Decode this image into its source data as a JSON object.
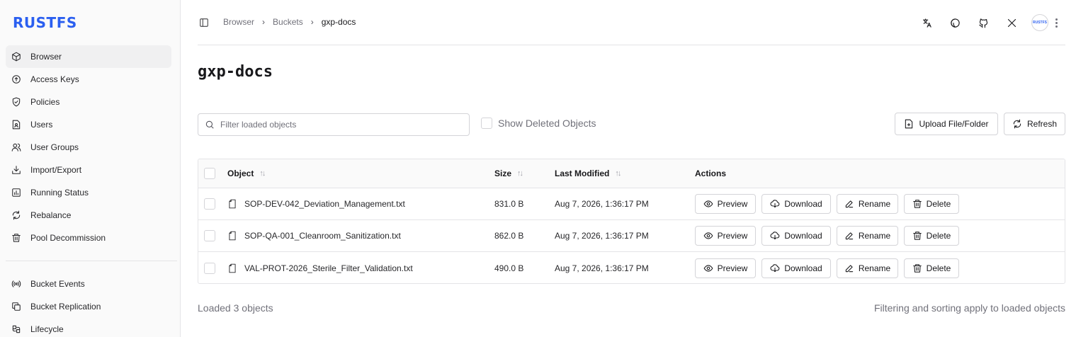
{
  "brand": {
    "logo": "RUSTFS",
    "logo_color": "#2b5ff0"
  },
  "sidebar": {
    "items": [
      {
        "label": "Browser",
        "icon": "box-icon",
        "active": true
      },
      {
        "label": "Access Keys",
        "icon": "key-circle-icon"
      },
      {
        "label": "Policies",
        "icon": "shield-check-icon"
      },
      {
        "label": "Users",
        "icon": "user-file-icon"
      },
      {
        "label": "User Groups",
        "icon": "users-icon"
      },
      {
        "label": "Import/Export",
        "icon": "download-tray-icon"
      },
      {
        "label": "Running Status",
        "icon": "bar-chart-icon"
      },
      {
        "label": "Rebalance",
        "icon": "refresh-icon"
      },
      {
        "label": "Pool Decommission",
        "icon": "trash-icon"
      }
    ],
    "items2": [
      {
        "label": "Bucket Events",
        "icon": "broadcast-icon"
      },
      {
        "label": "Bucket Replication",
        "icon": "copy-icon"
      },
      {
        "label": "Lifecycle",
        "icon": "lifecycle-icon"
      }
    ]
  },
  "topbar": {
    "breadcrumb": [
      "Browser",
      "Buckets",
      "gxp-docs"
    ],
    "icons": [
      "translate-icon",
      "theme-icon",
      "github-icon",
      "x-icon"
    ],
    "avatar_text": "RUSTFS"
  },
  "page": {
    "title": "gxp-docs",
    "search_placeholder": "Filter loaded objects",
    "show_deleted_label": "Show Deleted Objects",
    "upload_label": "Upload File/Folder",
    "refresh_label": "Refresh"
  },
  "table": {
    "headers": {
      "object": "Object",
      "size": "Size",
      "modified": "Last Modified",
      "actions": "Actions"
    },
    "action_labels": {
      "preview": "Preview",
      "download": "Download",
      "rename": "Rename",
      "delete": "Delete"
    },
    "rows": [
      {
        "name": "SOP-DEV-042_Deviation_Management.txt",
        "size": "831.0 B",
        "modified": "Aug 7, 2026, 1:36:17 PM"
      },
      {
        "name": "SOP-QA-001_Cleanroom_Sanitization.txt",
        "size": "862.0 B",
        "modified": "Aug 7, 2026, 1:36:17 PM"
      },
      {
        "name": "VAL-PROT-2026_Sterile_Filter_Validation.txt",
        "size": "490.0 B",
        "modified": "Aug 7, 2026, 1:36:17 PM"
      }
    ]
  },
  "footer": {
    "loaded": "Loaded 3 objects",
    "note": "Filtering and sorting apply to loaded objects"
  }
}
